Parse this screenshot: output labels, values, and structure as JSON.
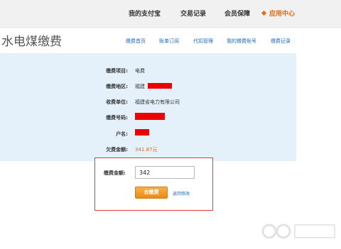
{
  "top_nav": {
    "items": [
      {
        "label": "我的支付宝"
      },
      {
        "label": "交易记录"
      },
      {
        "label": "会员保障"
      },
      {
        "label": "应用中心"
      }
    ]
  },
  "header": {
    "title": "水电煤缴费",
    "subnav": [
      {
        "label": "缴费首页"
      },
      {
        "label": "账单订阅"
      },
      {
        "label": "代扣管理"
      },
      {
        "label": "我的缴费账号"
      },
      {
        "label": "缴费记录"
      }
    ]
  },
  "info": {
    "rows": [
      {
        "label": "缴费项目:",
        "value": "电费"
      },
      {
        "label": "缴费地区:",
        "value": "福建"
      },
      {
        "label": "收费单位:",
        "value": "福建省电力有限公司"
      },
      {
        "label": "缴费号码:",
        "value": ""
      },
      {
        "label": "户名:",
        "value": ""
      },
      {
        "label": "欠费金额:",
        "value": "341.87元"
      }
    ]
  },
  "payment": {
    "label": "缴费金额:",
    "amount_value": "342",
    "submit_label": "去缴费",
    "back_label": "返回修改"
  },
  "colors": {
    "accent": "#e06a10",
    "link": "#1d6bb7",
    "panel_bg": "#e5f1fa",
    "highlight_border": "#e23a3a",
    "redaction": "#ee0000"
  }
}
